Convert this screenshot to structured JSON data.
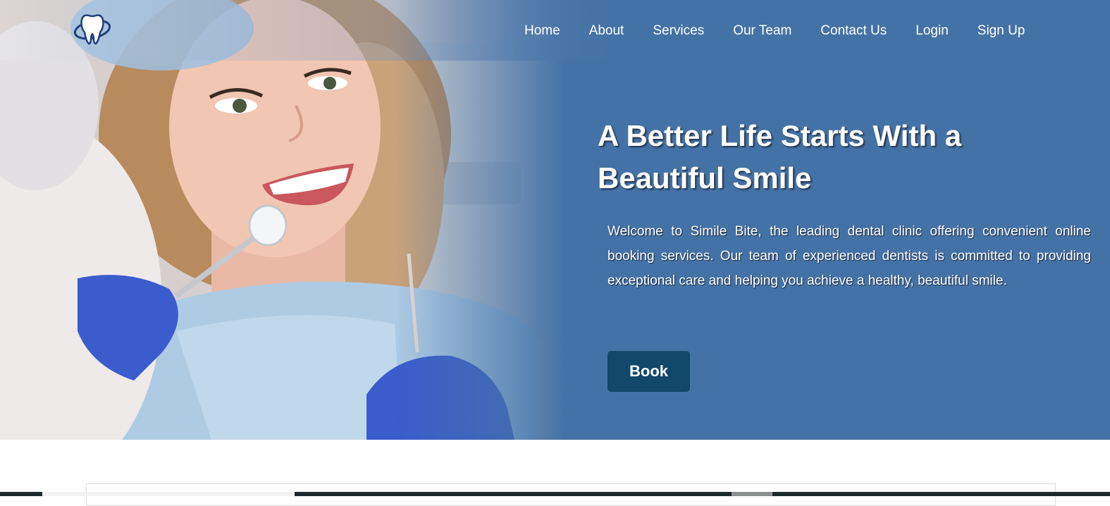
{
  "brand": {
    "logo_icon": "tooth-icon"
  },
  "nav": {
    "items": [
      "Home",
      "About",
      "Services",
      "Our Team",
      "Contact Us",
      "Login",
      "Sign Up"
    ]
  },
  "hero": {
    "headline": "A Better Life Starts With a Beautiful Smile",
    "intro": "Welcome to Simile Bite, the leading dental clinic offering convenient online booking services. Our team of experienced dentists is committed to providing exceptional care and helping you achieve a healthy, beautiful smile.",
    "book_label": "Book",
    "image_icon": "dental-patient-photo"
  },
  "colors": {
    "hero_bg": "#4572a6",
    "button_bg": "#12486a",
    "text": "#ffffff",
    "glove": "#3a5ccc"
  }
}
